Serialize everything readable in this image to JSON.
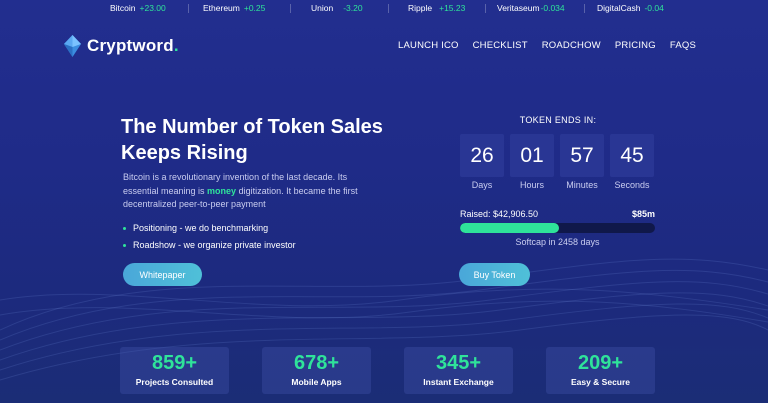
{
  "ticker": [
    {
      "name": "Bitcoin",
      "change": "+23.00"
    },
    {
      "name": "Ethereum",
      "change": "+0.25"
    },
    {
      "name": "Union",
      "change": "-3.20"
    },
    {
      "name": "Ripple",
      "change": "+15.23"
    },
    {
      "name": "Veritaseum",
      "change": "-0.034"
    },
    {
      "name": "DigitalCash",
      "change": "-0.04"
    }
  ],
  "brand": {
    "name": "Cryptword",
    "dot": "."
  },
  "nav": [
    "LAUNCH ICO",
    "CHECKLIST",
    "ROADCHOW",
    "PRICING",
    "FAQS"
  ],
  "hero": {
    "title": "The Number of Token Sales Keeps Rising",
    "text_before": "Bitcoin is a revolutionary invention of the last decade. Its essential meaning is ",
    "text_highlight": "money",
    "text_after": " digitization. It became the first decentralized peer-to-peer payment",
    "bullets": [
      "Positioning - we do benchmarking",
      "Roadshow - we organize private investor"
    ],
    "whitepaper_label": "Whitepaper"
  },
  "token": {
    "title": "TOKEN ENDS IN:",
    "countdown": [
      {
        "value": "26",
        "label": "Days"
      },
      {
        "value": "01",
        "label": "Hours"
      },
      {
        "value": "57",
        "label": "Minutes"
      },
      {
        "value": "45",
        "label": "Seconds"
      }
    ],
    "raised": "Raised: $42,906.50",
    "goal": "$85m",
    "progress_fraction": 0.51,
    "softcap": "Softcap in 2458 days",
    "buy_label": "Buy Token"
  },
  "stats": [
    {
      "value": "859+",
      "label": "Projects Consulted"
    },
    {
      "value": "678+",
      "label": "Mobile Apps"
    },
    {
      "value": "345+",
      "label": "Instant Exchange"
    },
    {
      "value": "209+",
      "label": "Easy & Secure"
    }
  ],
  "colors": {
    "accent": "#2fe39a",
    "background": "#1f2b88",
    "button": "#4fb4d9"
  }
}
